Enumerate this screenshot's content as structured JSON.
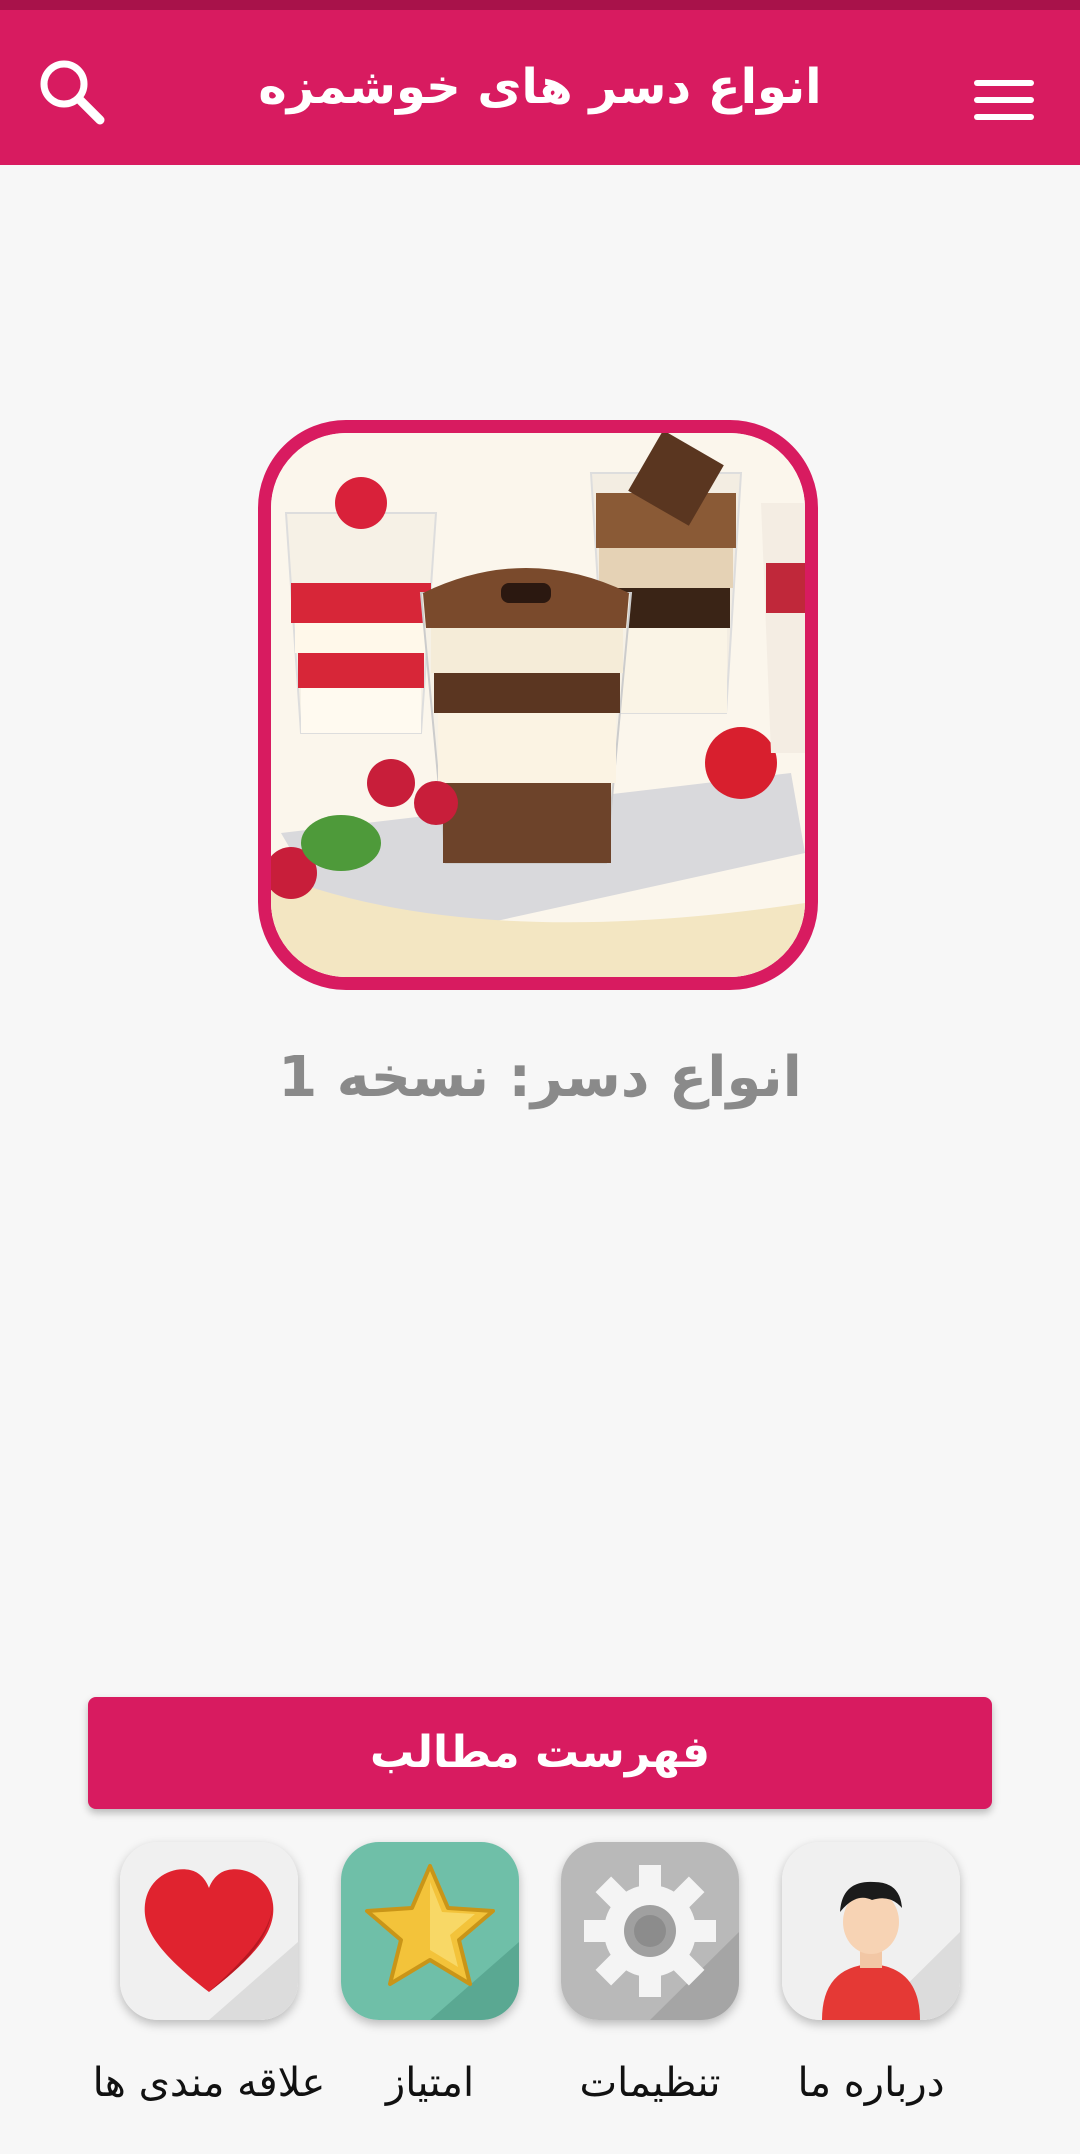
{
  "app_bar": {
    "title": "انواع دسر های خوشمزه",
    "color": "#d81b60",
    "left_icon": "search-icon",
    "right_icon": "menu-icon"
  },
  "main": {
    "cover_image": "dessert-cups-photo",
    "version_text": "انواع دسر: نسخه 1"
  },
  "toc_button": {
    "label": "فهرست مطالب"
  },
  "tiles": [
    {
      "label": "درباره ما",
      "icon": "user-icon"
    },
    {
      "label": "تنظیمات",
      "icon": "gear-icon"
    },
    {
      "label": "امتیاز",
      "icon": "star-icon"
    },
    {
      "label": "علاقه مندی ها",
      "icon": "heart-icon"
    }
  ]
}
